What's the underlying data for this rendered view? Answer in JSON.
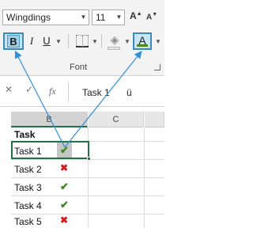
{
  "ribbon": {
    "font_name": "Wingdings",
    "font_size": "11",
    "grow_label": "A",
    "shrink_label": "A",
    "bold_label": "B",
    "italic_label": "I",
    "underline_label": "U",
    "font_color_label": "A",
    "font_color": "#4c8a1f",
    "group_label": "Font"
  },
  "formula_bar": {
    "fx_label": "fx",
    "cell_text": "Task 1",
    "glyph": "ü"
  },
  "sheet": {
    "columns": [
      "B",
      "C"
    ],
    "header": "Task",
    "rows": [
      {
        "task": "Task 1",
        "mark": "✔",
        "status": "check"
      },
      {
        "task": "Task 2",
        "mark": "✖",
        "status": "cross"
      },
      {
        "task": "Task 3",
        "mark": "✔",
        "status": "check"
      },
      {
        "task": "Task 4",
        "mark": "✔",
        "status": "check"
      },
      {
        "task": "Task 5",
        "mark": "✖",
        "status": "cross"
      }
    ],
    "check_color": "#3a8a1f",
    "cross_color": "#d21f1f",
    "selection_color": "#217346"
  }
}
